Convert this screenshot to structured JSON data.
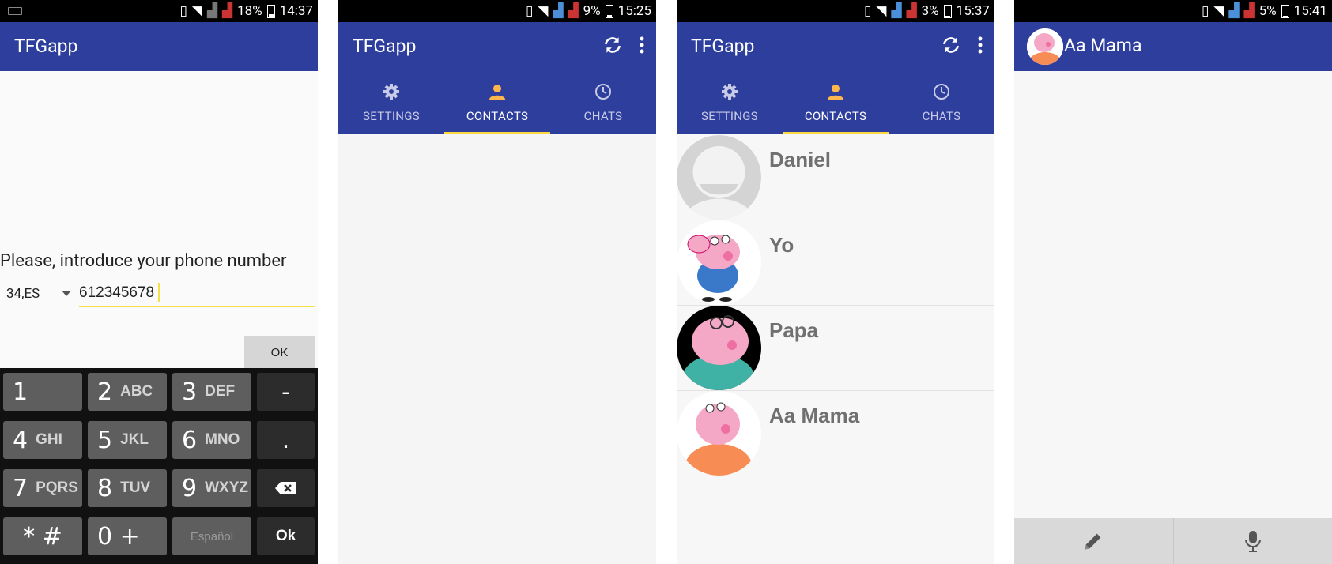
{
  "panels": [
    {
      "status": {
        "battery": "18%",
        "time": "14:37"
      },
      "app_title": "TFGapp",
      "prompt": "Please, introduce your phone number",
      "country_code": "34,ES",
      "phone_value": "612345678",
      "ok_label": "OK",
      "keyboard": {
        "keys": [
          {
            "main": "1",
            "sub": ""
          },
          {
            "main": "2",
            "sub": "ABC"
          },
          {
            "main": "3",
            "sub": "DEF"
          },
          {
            "main": "-",
            "sub": ""
          },
          {
            "main": "4",
            "sub": "GHI"
          },
          {
            "main": "5",
            "sub": "JKL"
          },
          {
            "main": "6",
            "sub": "MNO"
          },
          {
            "main": ".",
            "sub": ""
          },
          {
            "main": "7",
            "sub": "PQRS"
          },
          {
            "main": "8",
            "sub": "TUV"
          },
          {
            "main": "9",
            "sub": "WXYZ"
          },
          {
            "main": "",
            "sub": ""
          },
          {
            "main": "* #",
            "sub": ""
          },
          {
            "main": "0 +",
            "sub": ""
          },
          {
            "main": "Español",
            "sub": ""
          },
          {
            "main": "Ok",
            "sub": ""
          }
        ]
      }
    },
    {
      "status": {
        "battery": "9%",
        "time": "15:25"
      },
      "app_title": "TFGapp",
      "tabs": [
        {
          "label": "SETTINGS",
          "icon": "gear-icon"
        },
        {
          "label": "CONTACTS",
          "icon": "person-icon"
        },
        {
          "label": "CHATS",
          "icon": "clock-icon"
        }
      ],
      "active_tab": "CONTACTS"
    },
    {
      "status": {
        "battery": "3%",
        "time": "15:37"
      },
      "app_title": "TFGapp",
      "tabs": [
        {
          "label": "SETTINGS",
          "icon": "gear-icon"
        },
        {
          "label": "CONTACTS",
          "icon": "person-icon"
        },
        {
          "label": "CHATS",
          "icon": "clock-icon"
        }
      ],
      "active_tab": "CONTACTS",
      "contacts": [
        {
          "name": "Daniel",
          "avatar": "default-avatar"
        },
        {
          "name": "Yo",
          "avatar": "pig-blue-avatar"
        },
        {
          "name": "Papa",
          "avatar": "pig-teal-avatar"
        },
        {
          "name": "Aa Mama",
          "avatar": "pig-orange-avatar"
        }
      ]
    },
    {
      "status": {
        "battery": "5%",
        "time": "15:41"
      },
      "chat_title": "Aa Mama",
      "bottom_actions": [
        {
          "icon": "pencil-icon"
        },
        {
          "icon": "microphone-icon"
        }
      ]
    }
  ],
  "colors": {
    "primary": "#2e3e9d",
    "accent": "#ffd740",
    "key": "#5e5e5e"
  }
}
